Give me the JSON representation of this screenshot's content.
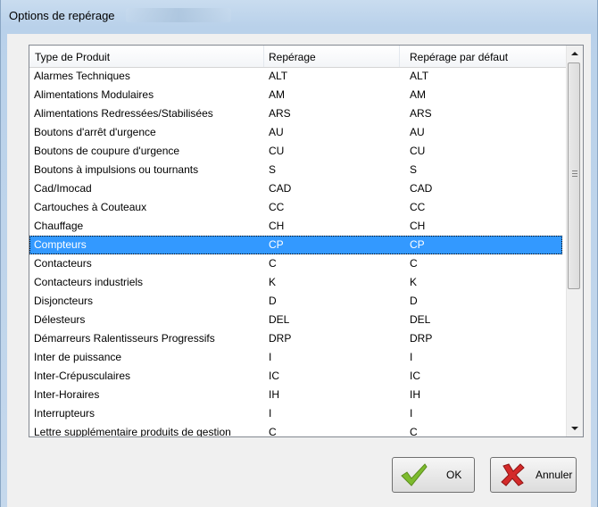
{
  "window": {
    "title": "Options de repérage"
  },
  "list": {
    "columns": [
      "Type de Produit",
      "Repérage",
      "Repérage par défaut"
    ],
    "rows": [
      [
        "Alarmes Techniques",
        "ALT",
        "ALT"
      ],
      [
        "Alimentations Modulaires",
        "AM",
        "AM"
      ],
      [
        "Alimentations Redressées/Stabilisées",
        "ARS",
        "ARS"
      ],
      [
        "Boutons d'arrêt d'urgence",
        "AU",
        "AU"
      ],
      [
        "Boutons de coupure d'urgence",
        "CU",
        "CU"
      ],
      [
        "Boutons à impulsions ou tournants",
        "S",
        "S"
      ],
      [
        "Cad/Imocad",
        "CAD",
        "CAD"
      ],
      [
        "Cartouches à Couteaux",
        "CC",
        "CC"
      ],
      [
        "Chauffage",
        "CH",
        "CH"
      ],
      [
        "Compteurs",
        "CP",
        "CP"
      ],
      [
        "Contacteurs",
        "C",
        "C"
      ],
      [
        "Contacteurs industriels",
        "K",
        "K"
      ],
      [
        "Disjoncteurs",
        "D",
        "D"
      ],
      [
        "Délesteurs",
        "DEL",
        "DEL"
      ],
      [
        "Démarreurs Ralentisseurs Progressifs",
        "DRP",
        "DRP"
      ],
      [
        "Inter de puissance",
        "I",
        "I"
      ],
      [
        "Inter-Crépusculaires",
        "IC",
        "IC"
      ],
      [
        "Inter-Horaires",
        "IH",
        "IH"
      ],
      [
        "Interrupteurs",
        "I",
        "I"
      ],
      [
        "Lettre supplémentaire produits de gestion",
        "C",
        "C"
      ]
    ],
    "selected_index": 9,
    "selection_color": "#3399ff"
  },
  "buttons": {
    "ok_label": "OK",
    "cancel_label": "Annuler"
  },
  "icons": {
    "ok": "check-icon",
    "cancel": "x-icon"
  }
}
